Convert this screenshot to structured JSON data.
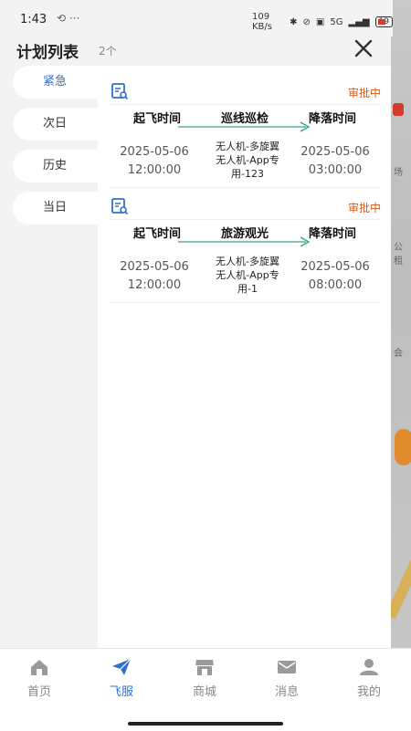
{
  "status_bar": {
    "time": "1:43",
    "extra": "⟲ ···",
    "net_speed": "109 KB/s",
    "signal": "5G",
    "battery": "19"
  },
  "header": {
    "title": "计划列表",
    "count": "2个",
    "close_icon": "close-icon"
  },
  "filters": [
    "紧急",
    "次日",
    "历史",
    "当日"
  ],
  "active_filter": "紧急",
  "cards": [
    {
      "status": "审批中",
      "col_takeoff": "起飞时间",
      "col_route": "巡线巡检",
      "col_landing": "降落时间",
      "takeoff_date": "2025-05-06",
      "takeoff_time": "12:00:00",
      "route_line1": "无人机-多旋翼",
      "route_line2": "无人机-App专",
      "route_line3": "用-123",
      "landing_date": "2025-05-06",
      "landing_time": "03:00:00"
    },
    {
      "status": "审批中",
      "col_takeoff": "起飞时间",
      "col_route": "旅游观光",
      "col_landing": "降落时间",
      "takeoff_date": "2025-05-06",
      "takeoff_time": "12:00:00",
      "route_line1": "无人机-多旋翼",
      "route_line2": "无人机-App专",
      "route_line3": "用-1",
      "landing_date": "2025-05-06",
      "landing_time": "08:00:00"
    }
  ],
  "map_labels": [
    "场",
    "公租",
    "会"
  ],
  "bottom_nav": [
    {
      "label": "首页",
      "icon": "home-icon"
    },
    {
      "label": "飞服",
      "icon": "paper-plane-icon"
    },
    {
      "label": "商城",
      "icon": "store-icon"
    },
    {
      "label": "消息",
      "icon": "mail-icon"
    },
    {
      "label": "我的",
      "icon": "user-icon"
    }
  ],
  "active_nav": "飞服",
  "colors": {
    "accent": "#2f6fd1",
    "status": "#d35b1d",
    "arrow": "#3aa37a"
  }
}
